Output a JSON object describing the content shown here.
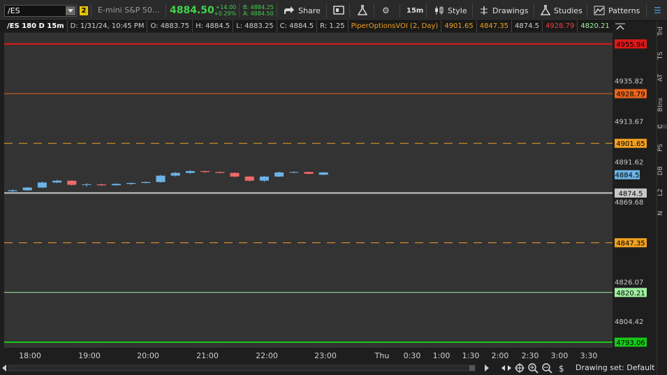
{
  "toolbar": {
    "symbol": "/ES",
    "link_badge": "2",
    "description": "E-mini S&P 50...",
    "last_price": "4884.50",
    "net_change": "+14.00",
    "pct_change": "+0.29%",
    "bid": "B: 4884.25",
    "ask": "A: 4884.50",
    "share_label": "Share",
    "timeframe_label": "15m",
    "style_label": "Style",
    "drawings_label": "Drawings",
    "studies_label": "Studies",
    "patterns_label": "Patterns"
  },
  "study_header": {
    "instrument": "/ES 180 D 15m",
    "date": "D: 1/31/24, 10:45 PM",
    "open": "O: 4883.75",
    "high": "H: 4884.5",
    "low": "L: 4883.25",
    "close": "C: 4884.5",
    "range": "R: 1.25",
    "study_name": "PiperOptionsVOI (2, Day)",
    "v1": "4901.65",
    "v2": "4847.35",
    "v3": "4874.5",
    "v4": "4928.79",
    "v5": "4820.21"
  },
  "right_rail": [
    "Trd",
    "TS",
    "AT",
    "Btns",
    "C",
    "PS",
    "DB",
    "L2",
    "N"
  ],
  "bottom": {
    "drawing_set": "Drawing set: Default"
  },
  "colors": {
    "up": "#6cb4e8",
    "down": "#f06a6a",
    "red_line": "#e01818",
    "orange_line": "#e8651e",
    "dashed_line": "#f0a020",
    "green_light": "#a0f0a0",
    "green": "#18c818",
    "grey_line": "#c8c8c8"
  },
  "chart_data": {
    "type": "candlestick",
    "ylim": [
      4790,
      4962
    ],
    "y_ticks": [
      "4935.82",
      "4913.67",
      "4891.62",
      "4869.68",
      "4826.07",
      "4804.42"
    ],
    "x_ticks": [
      "18:00",
      "19:00",
      "20:00",
      "21:00",
      "22:00",
      "23:00",
      "Thu",
      "0:30",
      "1:00",
      "1:30",
      "2:00",
      "2:30",
      "3:00",
      "3:30"
    ],
    "levels": [
      {
        "value": 4955.94,
        "label": "4955.94",
        "color": "#e01818",
        "style": "solid",
        "width": 2
      },
      {
        "value": 4928.79,
        "label": "4928.79",
        "color": "#e8651e",
        "style": "solid",
        "width": 1
      },
      {
        "value": 4901.65,
        "label": "4901.65",
        "color": "#f0a020",
        "style": "dashed",
        "width": 1
      },
      {
        "value": 4874.5,
        "label": "4874.5",
        "color": "#c8c8c8",
        "style": "solid",
        "width": 2
      },
      {
        "value": 4847.35,
        "label": "4847.35",
        "color": "#f0a020",
        "style": "dashed",
        "width": 1
      },
      {
        "value": 4820.21,
        "label": "4820.21",
        "color": "#a0f0a0",
        "style": "solid",
        "width": 1
      },
      {
        "value": 4793.06,
        "label": "4793.06",
        "color": "#18c818",
        "style": "solid",
        "width": 2
      }
    ],
    "last_price_label": "4884.5",
    "last_price": 4884.5,
    "candles": [
      {
        "o": 4875.5,
        "h": 4876.5,
        "l": 4874.5,
        "c": 4876.0
      },
      {
        "o": 4876.0,
        "h": 4877.75,
        "l": 4875.75,
        "c": 4877.5
      },
      {
        "o": 4877.5,
        "h": 4880.75,
        "l": 4877.25,
        "c": 4880.25
      },
      {
        "o": 4880.25,
        "h": 4881.75,
        "l": 4880.0,
        "c": 4881.25
      },
      {
        "o": 4881.25,
        "h": 4881.5,
        "l": 4878.5,
        "c": 4879.0
      },
      {
        "o": 4879.0,
        "h": 4880.0,
        "l": 4878.0,
        "c": 4879.25
      },
      {
        "o": 4879.25,
        "h": 4879.75,
        "l": 4878.25,
        "c": 4878.75
      },
      {
        "o": 4878.75,
        "h": 4879.75,
        "l": 4878.5,
        "c": 4879.5
      },
      {
        "o": 4879.5,
        "h": 4880.25,
        "l": 4879.0,
        "c": 4880.0
      },
      {
        "o": 4880.0,
        "h": 4880.75,
        "l": 4879.75,
        "c": 4880.5
      },
      {
        "o": 4880.5,
        "h": 4884.5,
        "l": 4880.25,
        "c": 4884.0
      },
      {
        "o": 4884.0,
        "h": 4886.0,
        "l": 4883.5,
        "c": 4885.5
      },
      {
        "o": 4885.5,
        "h": 4887.0,
        "l": 4885.0,
        "c": 4886.5
      },
      {
        "o": 4886.5,
        "h": 4886.75,
        "l": 4885.5,
        "c": 4886.0
      },
      {
        "o": 4886.0,
        "h": 4886.25,
        "l": 4885.25,
        "c": 4885.5
      },
      {
        "o": 4885.5,
        "h": 4885.75,
        "l": 4883.0,
        "c": 4883.5
      },
      {
        "o": 4883.5,
        "h": 4883.75,
        "l": 4880.75,
        "c": 4881.25
      },
      {
        "o": 4881.25,
        "h": 4883.75,
        "l": 4880.5,
        "c": 4883.5
      },
      {
        "o": 4883.5,
        "h": 4886.25,
        "l": 4883.25,
        "c": 4885.75
      },
      {
        "o": 4885.75,
        "h": 4886.5,
        "l": 4885.25,
        "c": 4886.0
      },
      {
        "o": 4886.0,
        "h": 4886.25,
        "l": 4884.75,
        "c": 4885.0
      },
      {
        "o": 4884.5,
        "h": 4886.0,
        "l": 4884.25,
        "c": 4885.75
      }
    ]
  }
}
